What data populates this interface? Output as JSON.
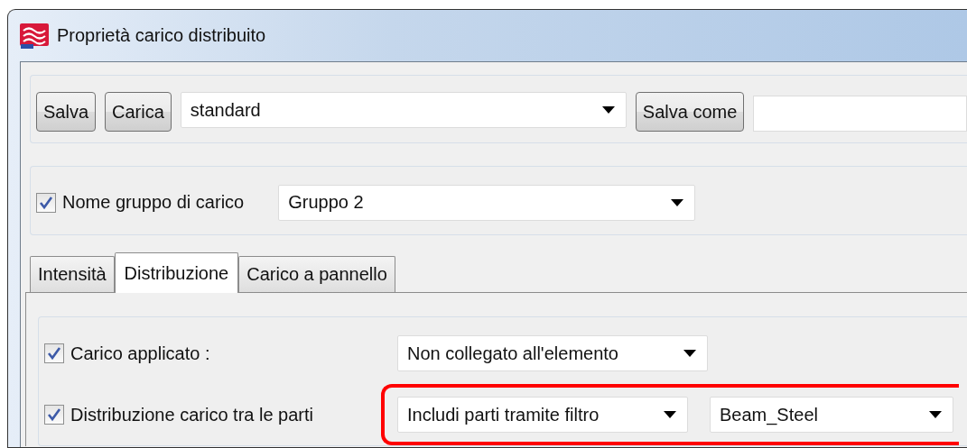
{
  "window": {
    "title": "Proprietà carico distribuito"
  },
  "toolbar": {
    "buttons": [
      {
        "label": "Salva"
      },
      {
        "label": "Carica"
      }
    ],
    "preset": {
      "value": "standard"
    },
    "save_as_button": {
      "label": "Salva come"
    }
  },
  "load_group": {
    "checked": true,
    "label": "Nome gruppo di carico",
    "value": "Gruppo 2"
  },
  "tabs": [
    {
      "label": "Intensità",
      "selected": false
    },
    {
      "label": "Distribuzione",
      "selected": true
    },
    {
      "label": "Carico a pannello",
      "selected": false
    }
  ],
  "distribution": {
    "rows": [
      {
        "checked": true,
        "label": "Carico applicato :",
        "highlighted": false,
        "combos": [
          {
            "value": "Non collegato all'elemento"
          }
        ]
      },
      {
        "checked": true,
        "label": "Distribuzione carico tra le parti",
        "highlighted": true,
        "combos": [
          {
            "value": "Includi parti tramite filtro"
          },
          {
            "value": "Beam_Steel"
          }
        ]
      }
    ]
  }
}
